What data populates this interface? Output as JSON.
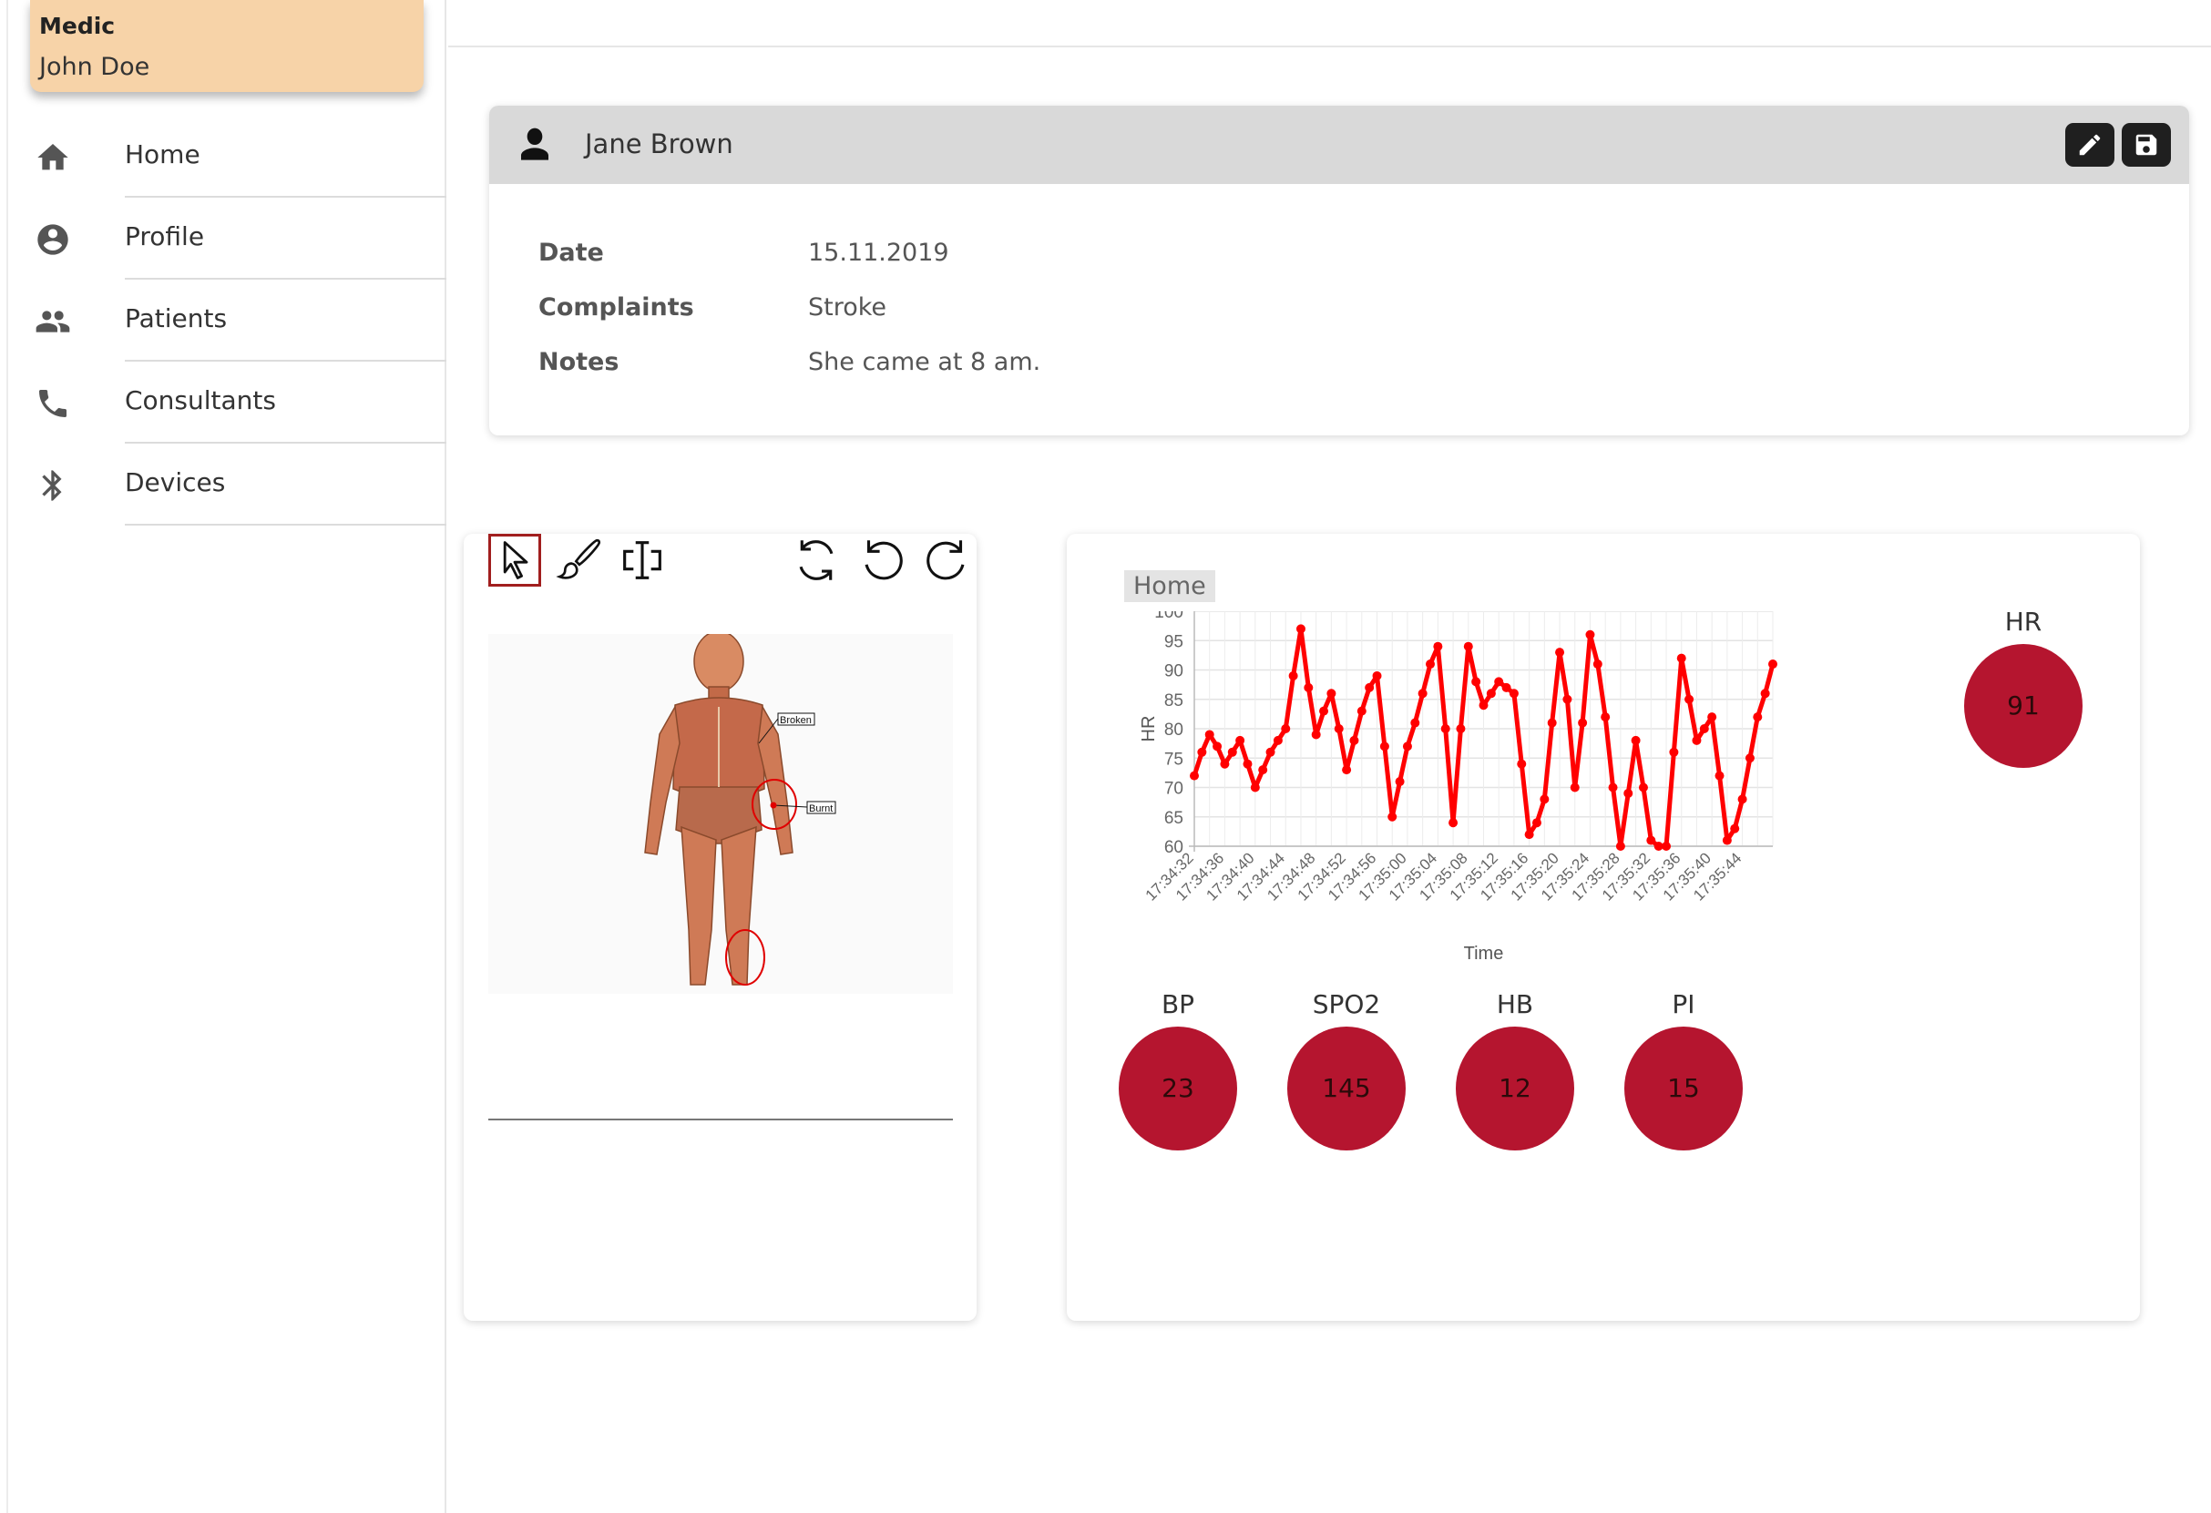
{
  "user": {
    "role": "Medic",
    "name": "John Doe"
  },
  "nav": {
    "items": [
      {
        "label": "Home",
        "icon": "home-icon"
      },
      {
        "label": "Profile",
        "icon": "account-circle-icon"
      },
      {
        "label": "Patients",
        "icon": "people-icon"
      },
      {
        "label": "Consultants",
        "icon": "phone-icon"
      },
      {
        "label": "Devices",
        "icon": "bluetooth-icon"
      }
    ]
  },
  "patient": {
    "name": "Jane Brown",
    "fields": [
      {
        "label": "Date",
        "value": "15.11.2019"
      },
      {
        "label": "Complaints",
        "value": "Stroke"
      },
      {
        "label": "Notes",
        "value": "She came at 8 am."
      }
    ]
  },
  "drawing": {
    "tools": [
      "pointer-icon",
      "brush-icon",
      "text-cursor-icon",
      "refresh-icon",
      "undo-icon",
      "redo-icon"
    ],
    "annotations": [
      "Broken",
      "Burnt"
    ]
  },
  "vitals": {
    "tab": "Home",
    "hr": {
      "label": "HR",
      "value": "91"
    },
    "circles": [
      {
        "label": "BP",
        "value": "23"
      },
      {
        "label": "SPO2",
        "value": "145"
      },
      {
        "label": "HB",
        "value": "12"
      },
      {
        "label": "PI",
        "value": "15"
      }
    ]
  },
  "chart_data": {
    "type": "line",
    "title": "",
    "xlabel": "Time",
    "ylabel": "HR",
    "ylim": [
      60,
      100
    ],
    "yticks": [
      60,
      65,
      70,
      75,
      80,
      85,
      90,
      95,
      100
    ],
    "grid": true,
    "color": "#ff0000",
    "x": [
      "17:34:32",
      "17:34:33",
      "17:34:34",
      "17:34:35",
      "17:34:36",
      "17:34:37",
      "17:34:38",
      "17:34:39",
      "17:34:40",
      "17:34:41",
      "17:34:42",
      "17:34:43",
      "17:34:44",
      "17:34:45",
      "17:34:46",
      "17:34:47",
      "17:34:48",
      "17:34:49",
      "17:34:50",
      "17:34:51",
      "17:34:52",
      "17:34:53",
      "17:34:54",
      "17:34:55",
      "17:34:56",
      "17:34:57",
      "17:34:58",
      "17:34:59",
      "17:35:00",
      "17:35:01",
      "17:35:02",
      "17:35:03",
      "17:35:04",
      "17:35:05",
      "17:35:06",
      "17:35:07",
      "17:35:08",
      "17:35:09",
      "17:35:10",
      "17:35:11",
      "17:35:12",
      "17:35:13",
      "17:35:14",
      "17:35:15",
      "17:35:16",
      "17:35:17",
      "17:35:18",
      "17:35:19",
      "17:35:20",
      "17:35:21",
      "17:35:22",
      "17:35:23",
      "17:35:24",
      "17:35:25",
      "17:35:26",
      "17:35:27",
      "17:35:28",
      "17:35:29",
      "17:35:30",
      "17:35:31",
      "17:35:32",
      "17:35:33",
      "17:35:34",
      "17:35:35",
      "17:35:36",
      "17:35:37",
      "17:35:38",
      "17:35:39",
      "17:35:40",
      "17:35:41",
      "17:35:42",
      "17:35:43",
      "17:35:44",
      "17:35:45",
      "17:35:46",
      "17:35:47",
      "17:35:48"
    ],
    "xtick_labels": [
      "17:34:32",
      "17:34:36",
      "17:34:40",
      "17:34:44",
      "17:34:48",
      "17:34:52",
      "17:34:56",
      "17:35:00",
      "17:35:04",
      "17:35:08",
      "17:35:12",
      "17:35:16",
      "17:35:20",
      "17:35:24",
      "17:35:28",
      "17:35:32",
      "17:35:36",
      "17:35:40",
      "17:35:44"
    ],
    "series": [
      {
        "values": [
          72,
          76,
          79,
          77,
          74,
          76,
          78,
          74,
          70,
          73,
          76,
          78,
          80,
          89,
          97,
          87,
          79,
          83,
          86,
          80,
          73,
          78,
          83,
          87,
          89,
          77,
          65,
          71,
          77,
          81,
          86,
          91,
          94,
          80,
          64,
          80,
          94,
          88,
          84,
          86,
          88,
          87,
          86,
          74,
          62,
          64,
          68,
          81,
          93,
          85,
          70,
          81,
          96,
          91,
          82,
          70,
          60,
          69,
          78,
          70,
          61,
          60,
          60,
          76,
          92,
          85,
          78,
          80,
          82,
          72,
          61,
          63,
          68,
          75,
          82,
          86,
          91
        ]
      }
    ]
  }
}
